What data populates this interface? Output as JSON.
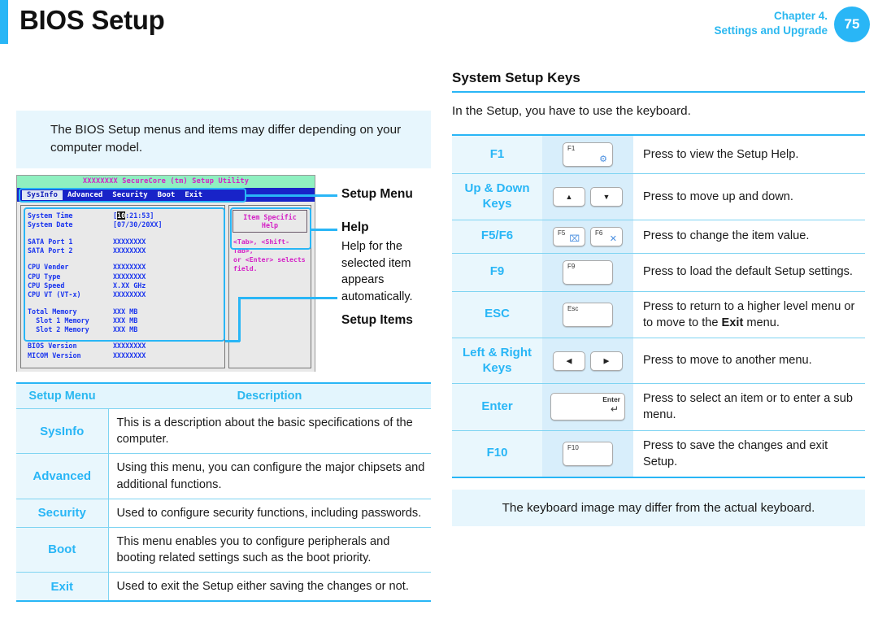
{
  "header": {
    "title": "BIOS Setup",
    "chapter": "Chapter 4.",
    "chapter_sub": "Settings and Upgrade",
    "page_number": "75",
    "accent_color": "#29b6f6"
  },
  "left": {
    "note": "The BIOS Setup menus and items may differ depending on your computer model.",
    "bios_screen": {
      "titlebar": "XXXXXXXX SecureCore (tm) Setup Utility",
      "menu_items": [
        "SysInfo",
        "Advanced",
        "Security",
        "Boot",
        "Exit"
      ],
      "active_menu": "SysInfo",
      "items": [
        {
          "label": "System Time",
          "value_pre": "[",
          "value_hl": "10",
          "value_post": ":21:53]"
        },
        {
          "label": "System Date",
          "value": "[07/30/20XX]"
        },
        {
          "spacer": true
        },
        {
          "label": "SATA Port 1",
          "value": "XXXXXXXX"
        },
        {
          "label": "SATA Port 2",
          "value": "XXXXXXXX"
        },
        {
          "spacer": true
        },
        {
          "label": "CPU Vender",
          "value": "XXXXXXXX"
        },
        {
          "label": "CPU Type",
          "value": "XXXXXXXX"
        },
        {
          "label": "CPU Speed",
          "value": "X.XX GHz"
        },
        {
          "label": "CPU VT (VT-x)",
          "value": "XXXXXXXX"
        },
        {
          "spacer": true
        },
        {
          "label": "Total Memory",
          "value": "XXX MB"
        },
        {
          "label": "  Slot 1 Memory",
          "value": "XXX MB"
        },
        {
          "label": "  Slot 2 Memory",
          "value": "XXX MB"
        },
        {
          "spacer": true
        },
        {
          "label": "BIOS Version",
          "value": "XXXXXXXX"
        },
        {
          "label": "MICOM Version",
          "value": "XXXXXXXX"
        }
      ],
      "help_title": "Item Specific Help",
      "help_text": "<Tab>, <Shift-Tab>,\nor <Enter> selects\nfield."
    },
    "annotations": {
      "setup_menu": "Setup Menu",
      "help": "Help",
      "help_desc": "Help for the selected item appears automatically.",
      "setup_items": "Setup Items"
    },
    "menu_table": {
      "headers": [
        "Setup Menu",
        "Description"
      ],
      "rows": [
        {
          "menu": "SysInfo",
          "description": "This is a description about the basic specifications of the computer."
        },
        {
          "menu": "Advanced",
          "description": "Using this menu, you can configure the major chipsets and additional functions."
        },
        {
          "menu": "Security",
          "description": "Used to configure security functions, including passwords."
        },
        {
          "menu": "Boot",
          "description": "This menu enables you to configure peripherals and booting related settings such as the boot priority."
        },
        {
          "menu": "Exit",
          "description": "Used to exit the Setup either saving the changes or not."
        }
      ]
    }
  },
  "right": {
    "section_title": "System Setup Keys",
    "section_lead": "In the Setup, you have to use the keyboard.",
    "keys": [
      {
        "name": "F1",
        "keycaps": [
          {
            "style": "wide",
            "top_left": "F1",
            "glyph": "help-gear-icon",
            "glyph_char": "⚙"
          }
        ],
        "description": "Press to view the Setup Help."
      },
      {
        "name": "Up & Down Keys",
        "keycaps": [
          {
            "style": "small",
            "arrow": "▲",
            "glyph": "arrow-up-icon"
          },
          {
            "style": "small",
            "arrow": "▼",
            "glyph": "arrow-down-icon"
          }
        ],
        "description": "Press to move up and down."
      },
      {
        "name": "F5/F6",
        "keycaps": [
          {
            "style": "small",
            "top_left": "F5",
            "glyph": "touchpad-off-icon",
            "glyph_char": "⌧"
          },
          {
            "style": "small",
            "top_left": "F6",
            "glyph": "mute-icon",
            "glyph_char": "✕"
          }
        ],
        "description": "Press to change the item value."
      },
      {
        "name": "F9",
        "keycaps": [
          {
            "style": "wide",
            "top_left": "F9"
          }
        ],
        "description": "Press to load the default Setup settings."
      },
      {
        "name": "ESC",
        "keycaps": [
          {
            "style": "wide",
            "top_left": "Esc"
          }
        ],
        "description_parts": [
          "Press to return to a higher level menu or to move to the ",
          "Exit",
          " menu."
        ],
        "description": "Press to return to a higher level menu or to move to the Exit menu."
      },
      {
        "name": "Left & Right Keys",
        "keycaps": [
          {
            "style": "small",
            "arrow": "◀",
            "glyph": "arrow-left-icon"
          },
          {
            "style": "small",
            "arrow": "▶",
            "glyph": "arrow-right-icon"
          }
        ],
        "description": "Press to move to another menu."
      },
      {
        "name": "Enter",
        "keycaps": [
          {
            "style": "enter",
            "top_right": "Enter",
            "return_glyph": "↵",
            "glyph": "enter-return-icon"
          }
        ],
        "description": "Press to select an item or to enter a sub menu."
      },
      {
        "name": "F10",
        "keycaps": [
          {
            "style": "wide",
            "top_left": "F10"
          }
        ],
        "description": "Press to save the changes and exit Setup."
      }
    ],
    "footnote": "The keyboard image may differ from the actual keyboard."
  }
}
